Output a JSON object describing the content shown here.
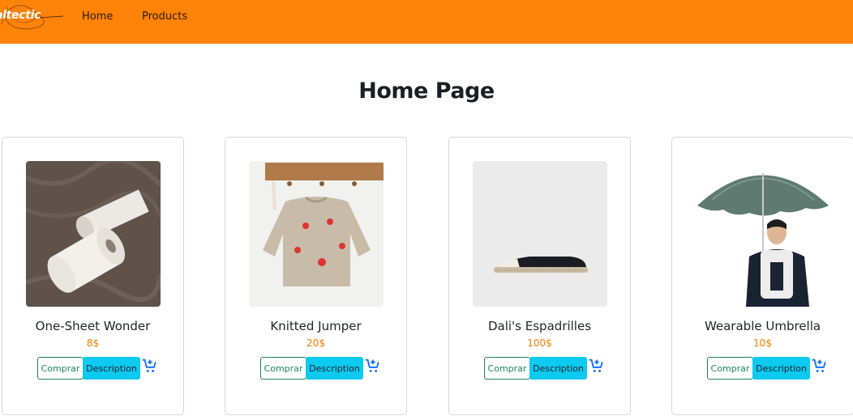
{
  "navbar": {
    "logo_text": "altectic",
    "links": [
      "Home",
      "Products"
    ],
    "background": "#ff8308"
  },
  "page": {
    "title": "Home Page"
  },
  "products": [
    {
      "name": "One-Sheet Wonder",
      "price": "8$",
      "buy_label": "Comprar",
      "desc_label": "Description",
      "image": "toilet-paper-image"
    },
    {
      "name": "Knitted Jumper",
      "price": "20$",
      "buy_label": "Comprar",
      "desc_label": "Description",
      "image": "knitted-jumper-image"
    },
    {
      "name": "Dali's Espadrilles",
      "price": "100$",
      "buy_label": "Comprar",
      "desc_label": "Description",
      "image": "espadrille-image"
    },
    {
      "name": "Wearable Umbrella",
      "price": "10$",
      "buy_label": "Comprar",
      "desc_label": "Description",
      "image": "umbrella-image"
    }
  ],
  "colors": {
    "accent": "#ff8308",
    "price": "#f57c00",
    "buy_outline": "#198754",
    "desc_button": "#0dcaf0",
    "cart_icon": "#0d6efd"
  }
}
